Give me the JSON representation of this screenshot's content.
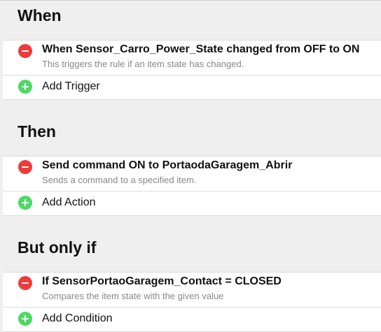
{
  "sections": [
    {
      "title": "When",
      "item": {
        "title": "When Sensor_Carro_Power_State changed from OFF to ON",
        "description": "This triggers the rule if an item state has changed."
      },
      "add_label": "Add Trigger"
    },
    {
      "title": "Then",
      "item": {
        "title": "Send command ON to PortaodaGaragem_Abrir",
        "description": "Sends a command to a specified item."
      },
      "add_label": "Add Action"
    },
    {
      "title": "But only if",
      "item": {
        "title": "If SensorPortaoGaragem_Contact = CLOSED",
        "description": "Compares the item state with the given value"
      },
      "add_label": "Add Condition"
    }
  ],
  "colors": {
    "remove": "#ef3b3b",
    "add": "#4cd964",
    "background": "#efefef"
  }
}
